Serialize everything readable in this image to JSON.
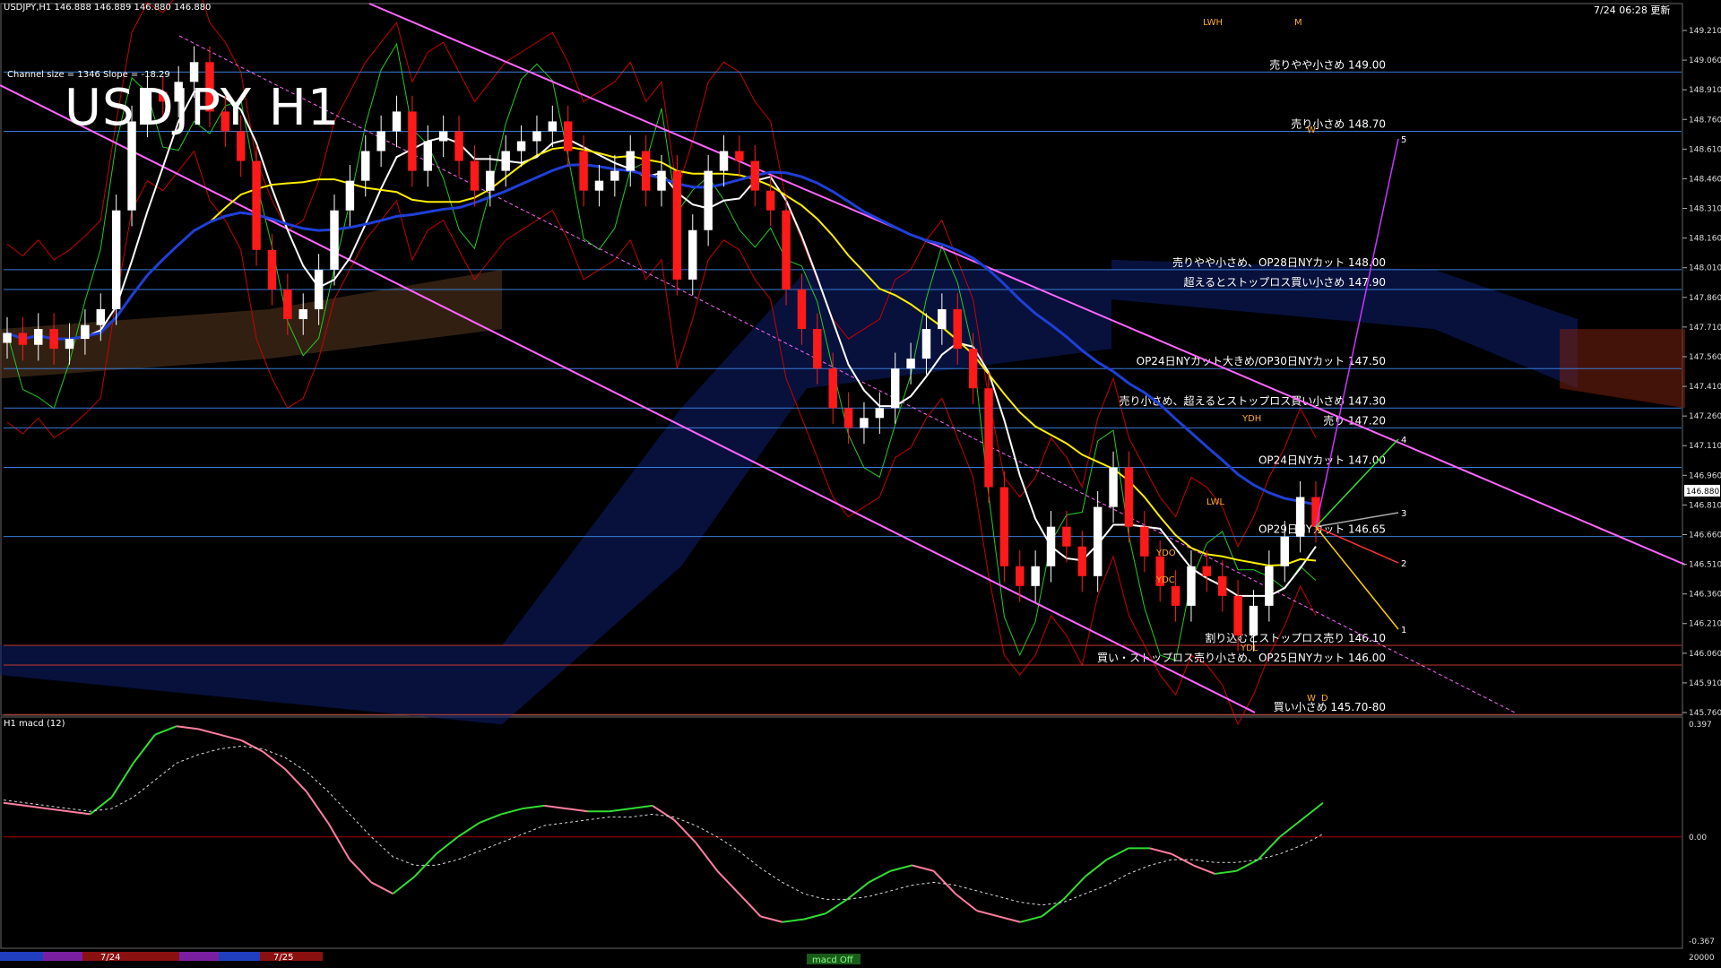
{
  "header": {
    "symbol_info": "USDJPY,H1  146.888 146.889 146.880 146.880",
    "channel_info": "Channel size = 1346 Slope = -18.29",
    "title": "USDJPY H1",
    "timestamp": "7/24 06:28 更新"
  },
  "colors": {
    "background": "#000000",
    "bull_candle": "#ffffff",
    "bear_candle": "#ff1a1a",
    "level_line": "#3a7bd5",
    "red_level": "#c0392b",
    "channel": "#ff66ff",
    "ma_white": "#ffffff",
    "ma_yellow": "#ffee00",
    "ma_blue": "#1f3fd8",
    "bollinger": "#cc0000",
    "chikou": "#22cc22",
    "macd_up": "#33dd33",
    "macd_down": "#ff7fa0"
  },
  "chart_data": [
    {
      "type": "candlestick",
      "symbol": "USDJPY",
      "timeframe": "H1",
      "ylim": [
        145.76,
        149.21
      ],
      "y_ticks": [
        "149.210",
        "149.060",
        "148.910",
        "148.760",
        "148.610",
        "148.460",
        "148.310",
        "148.160",
        "148.010",
        "147.860",
        "147.710",
        "147.560",
        "147.410",
        "147.260",
        "147.110",
        "146.960",
        "146.810",
        "146.660",
        "146.510",
        "146.360",
        "146.210",
        "146.060",
        "145.910",
        "145.760"
      ],
      "current_price": "146.880",
      "closes": [
        147.68,
        147.62,
        147.7,
        147.6,
        147.65,
        147.72,
        147.8,
        148.3,
        148.75,
        148.9,
        148.85,
        148.95,
        149.05,
        148.8,
        148.7,
        148.55,
        148.1,
        147.9,
        147.75,
        147.8,
        148.0,
        148.3,
        148.45,
        148.6,
        148.7,
        148.8,
        148.5,
        148.65,
        148.7,
        148.55,
        148.4,
        148.5,
        148.6,
        148.65,
        148.7,
        148.75,
        148.6,
        148.4,
        148.45,
        148.5,
        148.6,
        148.4,
        148.5,
        147.95,
        148.2,
        148.5,
        148.6,
        148.55,
        148.4,
        148.3,
        147.9,
        147.7,
        147.5,
        147.3,
        147.2,
        147.25,
        147.3,
        147.5,
        147.55,
        147.7,
        147.8,
        147.6,
        147.4,
        146.9,
        146.5,
        146.4,
        146.5,
        146.7,
        146.6,
        146.45,
        146.8,
        147.0,
        146.7,
        146.55,
        146.4,
        146.3,
        146.5,
        146.45,
        146.35,
        146.15,
        146.3,
        146.5,
        146.65,
        146.85,
        146.7
      ],
      "levels": [
        {
          "price": 149.0,
          "label": "売りやや小さめ 149.00"
        },
        {
          "price": 148.7,
          "label": "売り小さめ 148.70"
        },
        {
          "price": 148.0,
          "label": "売りやや小さめ、OP28日NYカット 148.00"
        },
        {
          "price": 147.9,
          "label": "超えるとストップロス買い小さめ 147.90"
        },
        {
          "price": 147.5,
          "label": "OP24日NYカット大きめ/OP30日NYカット 147.50"
        },
        {
          "price": 147.3,
          "label": "売り小さめ、超えるとストップロス買い小さめ 147.30"
        },
        {
          "price": 147.2,
          "label": "売り 147.20"
        },
        {
          "price": 147.0,
          "label": "OP24日NYカット 147.00"
        },
        {
          "price": 146.65,
          "label": "OP29日NYカット 146.65"
        },
        {
          "price": 146.1,
          "label": "割り込むとストップロス売り 146.10"
        },
        {
          "price": 146.0,
          "label": "買い・ストップロス売り小さめ、OP25日NYカット 146.00"
        },
        {
          "price": 145.75,
          "label": "買い小さめ 145.70-80"
        }
      ],
      "zone_labels": [
        "LWH",
        "M",
        "W",
        "YDH",
        "LWL",
        "YDO",
        "YDC",
        "YDL",
        "W",
        "D"
      ],
      "projection_labels": [
        "5",
        "4",
        "3",
        "2",
        "1"
      ]
    },
    {
      "type": "line",
      "title": "H1  macd (12)",
      "ylim": [
        -0.367,
        0.397
      ],
      "y_ticks": [
        "0.397",
        "0.00",
        "-0.367"
      ],
      "macd": [
        0.12,
        0.11,
        0.1,
        0.09,
        0.08,
        0.14,
        0.26,
        0.36,
        0.39,
        0.38,
        0.36,
        0.34,
        0.3,
        0.24,
        0.16,
        0.05,
        -0.08,
        -0.16,
        -0.2,
        -0.14,
        -0.06,
        0.0,
        0.05,
        0.08,
        0.1,
        0.11,
        0.1,
        0.09,
        0.09,
        0.1,
        0.11,
        0.06,
        -0.02,
        -0.12,
        -0.2,
        -0.28,
        -0.3,
        -0.29,
        -0.27,
        -0.22,
        -0.16,
        -0.12,
        -0.1,
        -0.12,
        -0.2,
        -0.26,
        -0.28,
        -0.3,
        -0.28,
        -0.22,
        -0.14,
        -0.08,
        -0.04,
        -0.04,
        -0.06,
        -0.1,
        -0.13,
        -0.12,
        -0.08,
        0.0,
        0.06,
        0.12
      ],
      "signal": [
        0.13,
        0.12,
        0.11,
        0.1,
        0.09,
        0.1,
        0.14,
        0.2,
        0.26,
        0.29,
        0.31,
        0.32,
        0.31,
        0.28,
        0.23,
        0.16,
        0.08,
        0.0,
        -0.07,
        -0.1,
        -0.1,
        -0.08,
        -0.05,
        -0.02,
        0.01,
        0.04,
        0.05,
        0.06,
        0.07,
        0.07,
        0.08,
        0.07,
        0.04,
        0.0,
        -0.05,
        -0.11,
        -0.16,
        -0.2,
        -0.22,
        -0.22,
        -0.21,
        -0.19,
        -0.17,
        -0.16,
        -0.17,
        -0.19,
        -0.21,
        -0.23,
        -0.24,
        -0.23,
        -0.2,
        -0.17,
        -0.13,
        -0.1,
        -0.08,
        -0.08,
        -0.09,
        -0.09,
        -0.08,
        -0.06,
        -0.03,
        0.01
      ]
    }
  ],
  "time_bar": {
    "labels": [
      "7/24",
      "7/25"
    ],
    "status": "macd Off"
  },
  "bottom_value": "20000"
}
